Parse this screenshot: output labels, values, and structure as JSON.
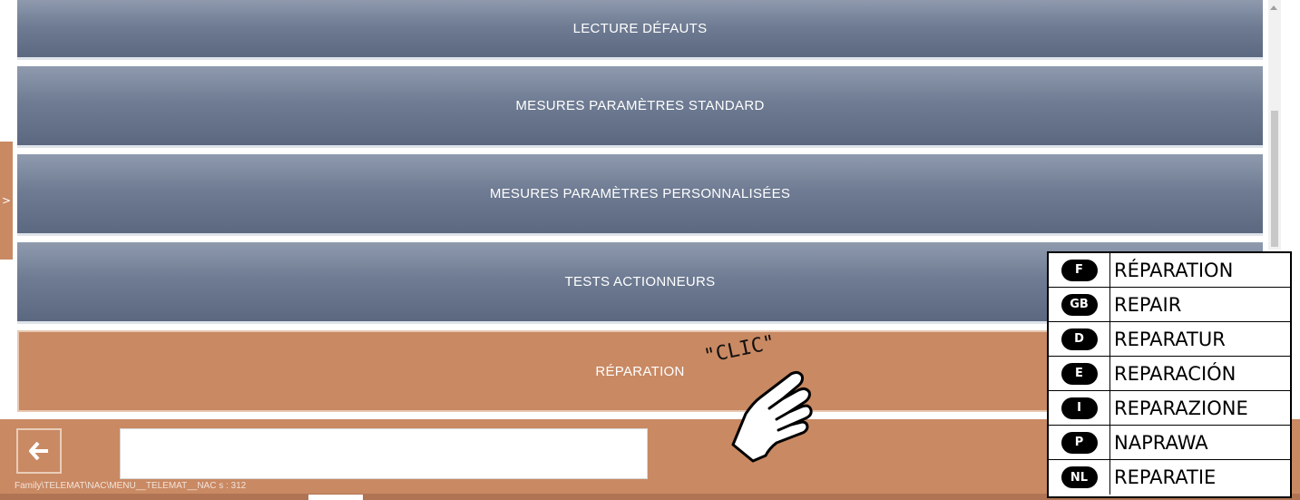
{
  "menu": {
    "items": [
      {
        "label": "LECTURE DÉFAUTS"
      },
      {
        "label": "MESURES PARAMÈTRES STANDARD"
      },
      {
        "label": "MESURES PARAMÈTRES PERSONNALISÉES"
      },
      {
        "label": "TESTS ACTIONNEURS"
      },
      {
        "label": "RÉPARATION",
        "selected": true
      }
    ]
  },
  "side_tab": {
    "glyph": ">"
  },
  "bottom_bar": {
    "back_icon": "arrow-left-icon",
    "input_value": "",
    "path_text": "Family\\TELEMAT\\NAC\\MENU__TELEMAT__NAC s : 312"
  },
  "annotation": {
    "clic_text": "\"CLIC\"",
    "hand_icon": "pointing-hand-icon"
  },
  "translations": [
    {
      "code": "F",
      "word": "RÉPARATION"
    },
    {
      "code": "GB",
      "word": "REPAIR"
    },
    {
      "code": "D",
      "word": "REPARATUR"
    },
    {
      "code": "E",
      "word": "REPARACIÓN"
    },
    {
      "code": "I",
      "word": "REPARAZIONE"
    },
    {
      "code": "P",
      "word": "NAPRAWA"
    },
    {
      "code": "NL",
      "word": "REPARATIE"
    }
  ],
  "colors": {
    "menu_button": "#6f7c93",
    "selected_button": "#c98963",
    "bottom_bar": "#c98963"
  }
}
